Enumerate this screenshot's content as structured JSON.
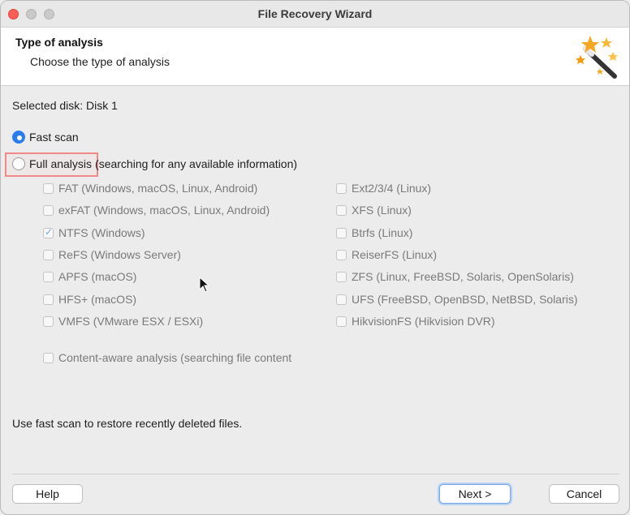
{
  "window": {
    "title": "File Recovery Wizard"
  },
  "header": {
    "title": "Type of analysis",
    "subtitle": "Choose the type of analysis",
    "icon": "magic-wand-stars-icon"
  },
  "selected_disk": "Selected disk: Disk 1",
  "scan_options": {
    "fast_scan": {
      "label": "Fast scan",
      "selected": true
    },
    "full_analysis": {
      "label": "Full analysis",
      "suffix": "(searching for any available information)",
      "selected": false
    }
  },
  "filesystems_left": [
    {
      "label": "FAT (Windows, macOS, Linux, Android)",
      "checked": false
    },
    {
      "label": "exFAT (Windows, macOS, Linux, Android)",
      "checked": false
    },
    {
      "label": "NTFS (Windows)",
      "checked": true
    },
    {
      "label": "ReFS (Windows Server)",
      "checked": false
    },
    {
      "label": "APFS (macOS)",
      "checked": false
    },
    {
      "label": "HFS+ (macOS)",
      "checked": false
    },
    {
      "label": "VMFS (VMware ESX / ESXi)",
      "checked": false
    }
  ],
  "filesystems_right": [
    {
      "label": "Ext2/3/4 (Linux)",
      "checked": false
    },
    {
      "label": "XFS (Linux)",
      "checked": false
    },
    {
      "label": "Btrfs (Linux)",
      "checked": false
    },
    {
      "label": "ReiserFS (Linux)",
      "checked": false
    },
    {
      "label": "ZFS (Linux, FreeBSD, Solaris, OpenSolaris)",
      "checked": false
    },
    {
      "label": "UFS (FreeBSD, OpenBSD, NetBSD, Solaris)",
      "checked": false
    },
    {
      "label": "HikvisionFS (Hikvision DVR)",
      "checked": false
    }
  ],
  "content_aware": {
    "label": "Content-aware analysis (searching file content",
    "checked": false
  },
  "hint": "Use fast scan to restore recently deleted files.",
  "buttons": {
    "help": "Help",
    "next": "Next >",
    "cancel": "Cancel"
  }
}
